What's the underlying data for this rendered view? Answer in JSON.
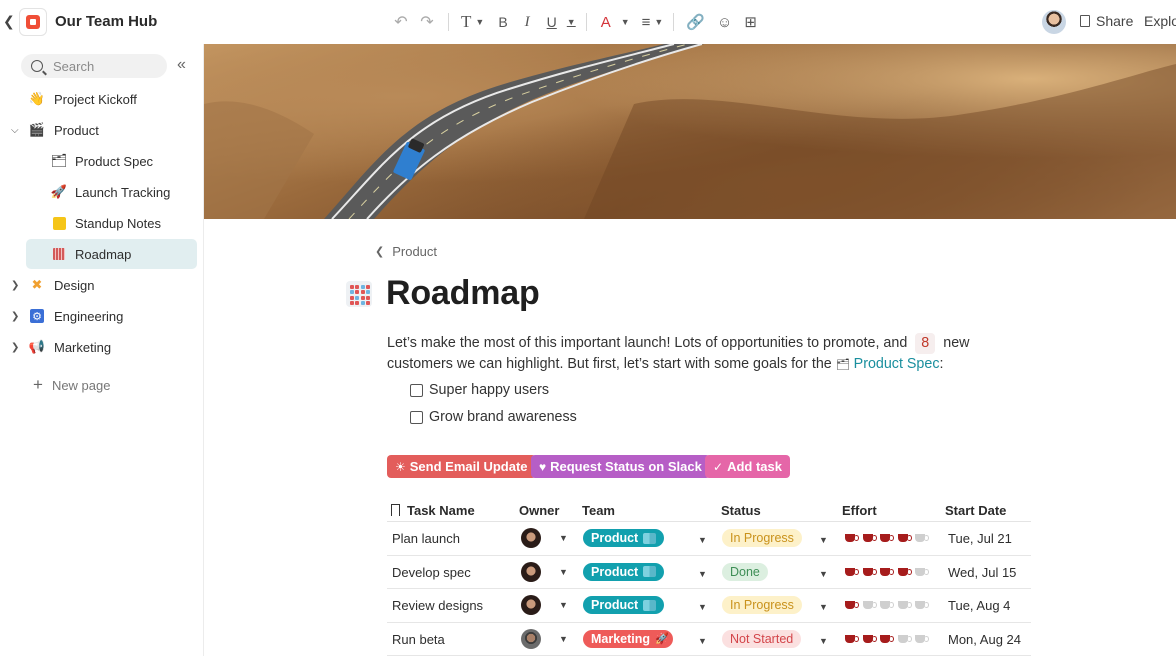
{
  "header": {
    "hub_title": "Our Team Hub",
    "share_label": "Share",
    "explore_label": "Explo",
    "toolbar_icons": [
      "undo-icon",
      "redo-icon",
      "text-style-icon",
      "bold-icon",
      "italic-icon",
      "underline-icon",
      "text-color-icon",
      "align-icon",
      "link-icon",
      "emoji-icon",
      "add-comment-icon"
    ]
  },
  "sidebar": {
    "search_placeholder": "Search",
    "items": [
      {
        "label": "Project Kickoff",
        "icon": "waving-hand-icon",
        "level": 0,
        "expandable": false,
        "active": false
      },
      {
        "label": "Product",
        "icon": "clapper-board-icon",
        "level": 0,
        "expandable": true,
        "expanded": true,
        "active": false
      },
      {
        "label": "Product Spec",
        "icon": "stacked-docs-icon",
        "level": 1,
        "expandable": false,
        "active": false
      },
      {
        "label": "Launch Tracking",
        "icon": "rocket-icon",
        "level": 1,
        "expandable": false,
        "active": false
      },
      {
        "label": "Standup Notes",
        "icon": "sticky-note-icon",
        "level": 1,
        "expandable": false,
        "active": false
      },
      {
        "label": "Roadmap",
        "icon": "calendar-grid-icon",
        "level": 1,
        "expandable": false,
        "active": true
      },
      {
        "label": "Design",
        "icon": "pencil-ruler-icon",
        "level": 0,
        "expandable": true,
        "active": false
      },
      {
        "label": "Engineering",
        "icon": "gear-icon",
        "level": 0,
        "expandable": true,
        "active": false
      },
      {
        "label": "Marketing",
        "icon": "megaphone-icon",
        "level": 0,
        "expandable": true,
        "active": false
      }
    ],
    "new_page_label": "New page"
  },
  "page": {
    "breadcrumb": "Product",
    "title": "Roadmap",
    "intro_part1": "Let’s make the most of this important launch! Lots of opportunities to promote, and",
    "intro_count": "8",
    "intro_part2": "new customers we can highlight. But first, let’s start with some goals for the",
    "intro_link": "Product Spec",
    "intro_end": ":",
    "goals": [
      "Super happy users",
      "Grow brand awareness"
    ],
    "buttons": {
      "email": "Send Email Update",
      "slack": "Request Status on Slack",
      "task": "Add task"
    }
  },
  "table": {
    "headers": [
      "Task Name",
      "Owner",
      "Team",
      "Status",
      "Effort",
      "Start Date"
    ],
    "rows": [
      {
        "task": "Plan launch",
        "owner": "female-avatar",
        "team": "Product",
        "status": "In Progress",
        "effort": 4,
        "effort_max": 5,
        "start": "Tue, Jul 21"
      },
      {
        "task": "Develop spec",
        "owner": "female-avatar",
        "team": "Product",
        "status": "Done",
        "effort": 4,
        "effort_max": 5,
        "start": "Wed, Jul 15"
      },
      {
        "task": "Review designs",
        "owner": "female-avatar",
        "team": "Product",
        "status": "In Progress",
        "effort": 1,
        "effort_max": 5,
        "start": "Tue, Aug 4"
      },
      {
        "task": "Run beta",
        "owner": "male-avatar",
        "team": "Marketing",
        "status": "Not Started",
        "effort": 3,
        "effort_max": 5,
        "start": "Mon, Aug 24"
      }
    ]
  },
  "colors": {
    "accent_teal": "#12a0ae",
    "email_button": "#e35d5b",
    "slack_button": "#b65ec6",
    "task_button": "#e566a8",
    "effort_on": "#a61c1c"
  }
}
